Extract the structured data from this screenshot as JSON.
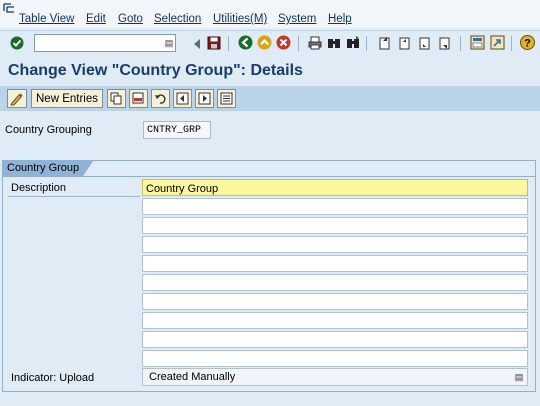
{
  "menu": [
    "Table View",
    "Edit",
    "Goto",
    "Selection",
    "Utilities(M)",
    "System",
    "Help"
  ],
  "icons": {
    "app": "sap-menu-icon",
    "enter": "check-icon",
    "dropdown": "dropdown-icon",
    "back_history": "history-back-icon",
    "save": "save-icon",
    "back": "back-icon",
    "exit": "exit-icon",
    "cancel": "cancel-icon",
    "print": "print-icon",
    "find": "find-icon",
    "find_next": "find-next-icon",
    "first_page": "first-page-icon",
    "prev_page": "previous-page-icon",
    "next_page": "next-page-icon",
    "last_page": "last-page-icon",
    "new_session": "new-session-icon",
    "shortcut": "shortcut-icon",
    "help": "help-icon"
  },
  "command_field": {
    "value": ""
  },
  "title": "Change View \"Country Group\": Details",
  "app_toolbar": {
    "new_entries": "New Entries",
    "icons": [
      "display-change-icon",
      "copy-icon",
      "delete-icon",
      "undo-icon",
      "previous-entry-icon",
      "next-entry-icon",
      "variable-list-icon"
    ]
  },
  "country_grouping": {
    "label": "Country Grouping",
    "value": "CNTRY_GRP"
  },
  "group_box": {
    "title": "Country Group",
    "description_label": "Description",
    "descriptions": [
      "Country Group",
      "",
      "",
      "",
      "",
      "",
      "",
      "",
      "",
      ""
    ],
    "indicator_label": "Indicator: Upload",
    "indicator_value": "Created Manually"
  },
  "colors": {
    "background": "#dfebf5",
    "title": "#1a3d6d",
    "app_toolbar": "#b9d3ea",
    "highlight_field": "#fdf69c",
    "group_tab": "#8fb2d7"
  }
}
